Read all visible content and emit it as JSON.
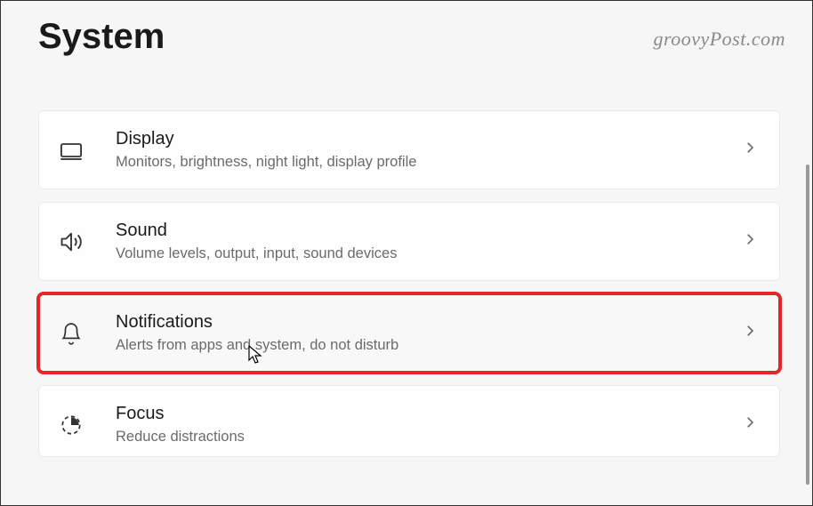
{
  "header": {
    "title": "System",
    "watermark": "groovyPost.com"
  },
  "items": [
    {
      "icon": "display",
      "title": "Display",
      "desc": "Monitors, brightness, night light, display profile",
      "highlighted": false
    },
    {
      "icon": "sound",
      "title": "Sound",
      "desc": "Volume levels, output, input, sound devices",
      "highlighted": false
    },
    {
      "icon": "notifications",
      "title": "Notifications",
      "desc": "Alerts from apps and system, do not disturb",
      "highlighted": true
    },
    {
      "icon": "focus",
      "title": "Focus",
      "desc": "Reduce distractions",
      "highlighted": false
    }
  ]
}
